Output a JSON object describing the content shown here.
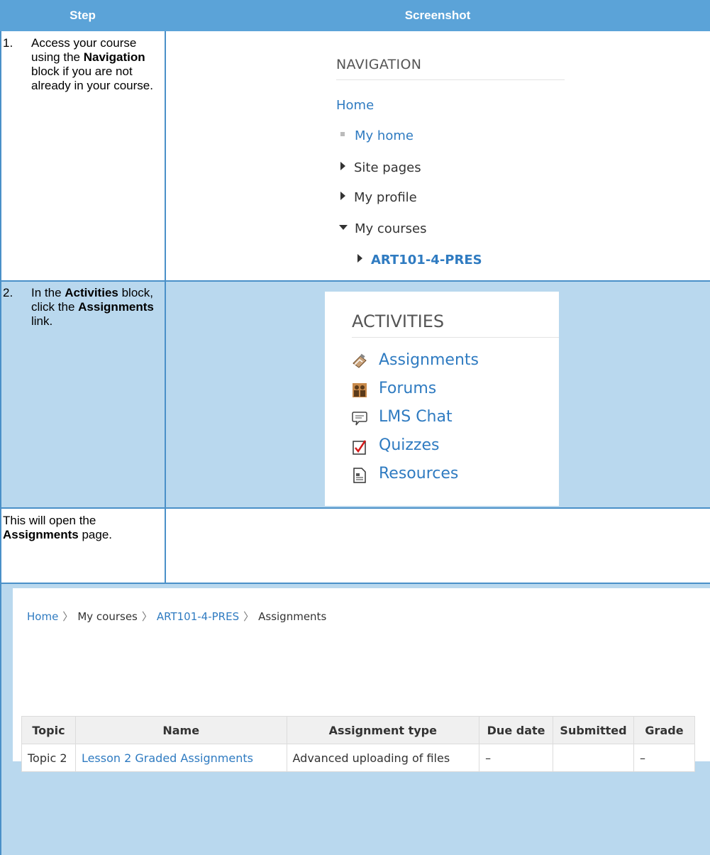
{
  "header": {
    "step_label": "Step",
    "screenshot_label": "Screenshot"
  },
  "rows": [
    {
      "num": "1.",
      "text_parts": [
        "Access your course using the ",
        "Navigation",
        " block if you are not already in your course."
      ]
    },
    {
      "num": "2.",
      "text_parts": [
        "In the ",
        "Activities",
        " block, click the ",
        "Assignments",
        " link."
      ]
    },
    {
      "text_parts": [
        "This will open the ",
        "Assignments",
        " page."
      ]
    }
  ],
  "navigation": {
    "title": "NAVIGATION",
    "home": "Home",
    "items": [
      "My home",
      "Site pages",
      "My profile",
      "My courses",
      "ART101-4-PRES"
    ]
  },
  "activities": {
    "title": "ACTIVITIES",
    "items": [
      {
        "label": "Assignments",
        "icon": "assignment-icon"
      },
      {
        "label": "Forums",
        "icon": "forum-icon"
      },
      {
        "label": "LMS Chat",
        "icon": "chat-icon"
      },
      {
        "label": "Quizzes",
        "icon": "quiz-icon"
      },
      {
        "label": "Resources",
        "icon": "resource-icon"
      }
    ]
  },
  "breadcrumb": {
    "home": "Home",
    "courses": "My courses",
    "course": "ART101-4-PRES",
    "page": "Assignments",
    "separator": "〉"
  },
  "assignments_table": {
    "headers": [
      "Topic",
      "Name",
      "Assignment type",
      "Due date",
      "Submitted",
      "Grade"
    ],
    "rows": [
      {
        "topic": "Topic 2",
        "name": "Lesson 2 Graded Assignments",
        "type": "Advanced uploading of files",
        "due": "–",
        "submitted": "",
        "grade": "–"
      }
    ]
  },
  "colors": {
    "header_bg": "#5ba3d8",
    "row_bg": "#b9d8ee",
    "link": "#2f7bc1"
  }
}
